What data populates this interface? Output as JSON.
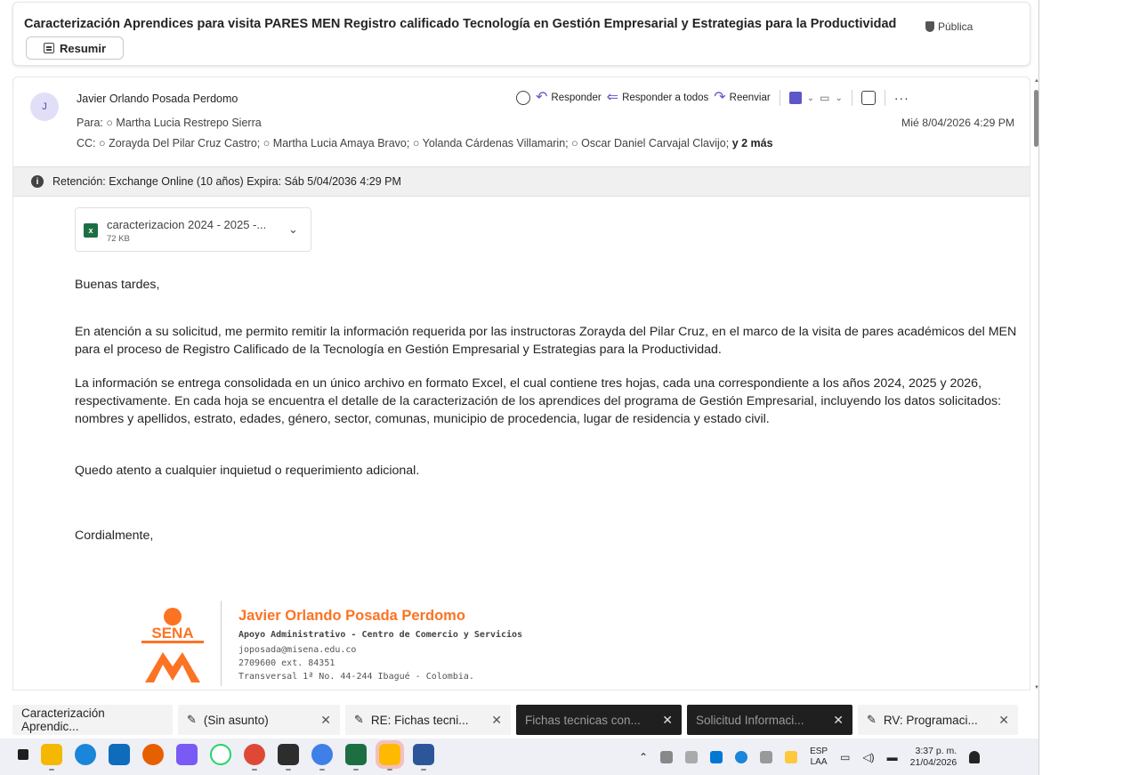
{
  "subject": "Caracterización Aprendices para visita PARES MEN Registro calificado Tecnología en Gestión Empresarial y Estrategias para la Productividad",
  "sensitivity": "Pública",
  "summarize_label": "Resumir",
  "message": {
    "avatar_initial": "J",
    "sender": "Javier Orlando Posada Perdomo",
    "to_label": "Para:",
    "to": "Martha Lucia Restrepo Sierra",
    "cc_label": "CC:",
    "cc": [
      "Zorayda Del Pilar Cruz Castro;",
      "Martha Lucia Amaya Bravo;",
      "Yolanda Cárdenas Villamarin;",
      "Oscar Daniel Carvajal Clavijo;"
    ],
    "cc_more": "y 2 más",
    "date": "Mié 8/04/2026 4:29 PM",
    "actions": {
      "reply": "Responder",
      "reply_all": "Responder a todos",
      "forward": "Reenviar"
    }
  },
  "retention": "Retención: Exchange Online (10 años) Expira: Sáb 5/04/2036 4:29 PM",
  "attachment": {
    "name": "caracterizacion 2024 - 2025 -...",
    "size": "72 KB"
  },
  "body": {
    "greeting": "Buenas tardes,",
    "p1": "En atención a su solicitud, me permito remitir la información requerida por las instructoras Zorayda del Pilar Cruz, en el marco de la visita de pares académicos del MEN para el proceso de Registro Calificado de la Tecnología en Gestión Empresarial y Estrategias para la Productividad.",
    "p2": "La información se entrega consolidada en un único archivo en formato Excel, el cual contiene tres hojas, cada una correspondiente a los años 2024, 2025 y 2026, respectivamente. En cada hoja se encuentra el detalle de la caracterización de los aprendices del programa de Gestión Empresarial, incluyendo los datos solicitados: nombres y apellidos, estrato, edades, género, sector, comunas, municipio de procedencia, lugar de residencia y estado civil.",
    "p3": "Quedo atento a cualquier inquietud o requerimiento adicional.",
    "closing": "Cordialmente,"
  },
  "signature": {
    "logo_text": "SENA",
    "name": "Javier Orlando Posada Perdomo",
    "role": "Apoyo Administrativo - Centro de Comercio y Servicios",
    "email": "joposada@misena.edu.co",
    "phone": "2709600 ext. 84351",
    "address": "Transversal 1ª No. 44-244 Ibagué - Colombia."
  },
  "tabs": [
    {
      "label": "Caracterización Aprendic...",
      "dark": false
    },
    {
      "label": "(Sin asunto)",
      "dark": false
    },
    {
      "label": "RE: Fichas tecni...",
      "dark": false
    },
    {
      "label": "Fichas tecnicas con...",
      "dark": true
    },
    {
      "label": "Solicitud Informaci...",
      "dark": true
    },
    {
      "label": "RV: Programaci...",
      "dark": false
    }
  ],
  "tray": {
    "lang_top": "ESP",
    "lang_bottom": "LAA",
    "time": "3:37 p. m.",
    "date": "21/04/2026"
  },
  "colors": {
    "accent": "#5b57c9",
    "sena_orange": "#fc7323",
    "retention_bg": "#f0f0f0"
  }
}
